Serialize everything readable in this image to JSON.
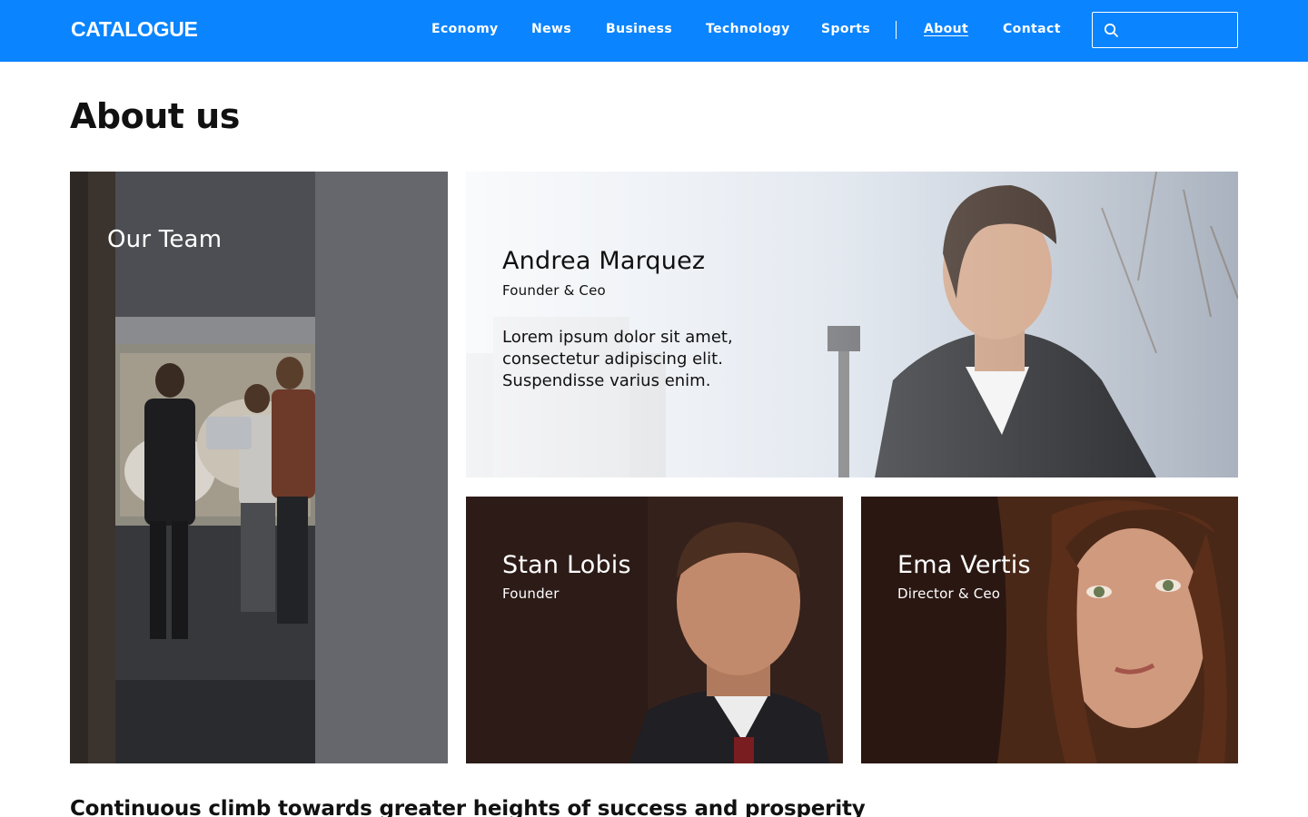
{
  "header": {
    "logo": "CATALOGUE",
    "nav": [
      "Economy",
      "News",
      "Business",
      "Technology",
      "Sports",
      "About",
      "Contact"
    ],
    "active": "About",
    "search_placeholder": "",
    "accent": "#0a84ff"
  },
  "page": {
    "title": "About us",
    "bottom_heading": "Continuous climb towards greater heights of success and prosperity"
  },
  "cards": {
    "team": {
      "title": "Our Team"
    },
    "andrea": {
      "name": "Andrea Marquez",
      "role": "Founder & Ceo",
      "description": "Lorem ipsum dolor sit amet, consectetur adipiscing elit. Suspendisse varius enim."
    },
    "stan": {
      "name": "Stan Lobis",
      "role": "Founder"
    },
    "ema": {
      "name": "Ema Vertis",
      "role": "Director & Ceo"
    }
  },
  "icons": {
    "search": "search-icon"
  }
}
